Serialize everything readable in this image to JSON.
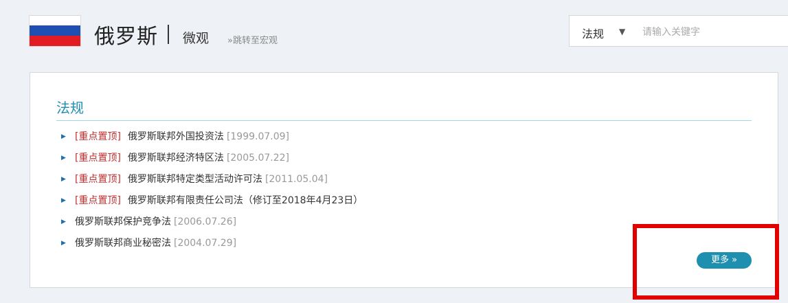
{
  "header": {
    "country": "俄罗斯",
    "view_label": "微观",
    "jump_link": "»跳转至宏观"
  },
  "search": {
    "category": "法规",
    "placeholder": "请输入关键字",
    "value": ""
  },
  "section": {
    "title": "法规",
    "items": [
      {
        "tag": "[重点置顶]",
        "title": "俄罗斯联邦外国投资法",
        "date": "[1999.07.09]"
      },
      {
        "tag": "[重点置顶]",
        "title": "俄罗斯联邦经济特区法",
        "date": "[2005.07.22]"
      },
      {
        "tag": "[重点置顶]",
        "title": "俄罗斯联邦特定类型活动许可法",
        "date": "[2011.05.04]"
      },
      {
        "tag": "[重点置顶]",
        "title": "俄罗斯联邦有限责任公司法（修订至2018年4月23日）",
        "date": ""
      },
      {
        "tag": "",
        "title": "俄罗斯联邦保护竞争法",
        "date": "[2006.07.26]"
      },
      {
        "tag": "",
        "title": "俄罗斯联邦商业秘密法",
        "date": "[2004.07.29]"
      }
    ],
    "more_label": "更多 »"
  },
  "colors": {
    "accent": "#1f8fb0",
    "tag": "#c22f2f",
    "highlight": "#e00000"
  },
  "icons": {
    "flag": "russia-flag-icon",
    "caret": "caret-down-icon",
    "bullet": "triangle-bullet-icon"
  }
}
